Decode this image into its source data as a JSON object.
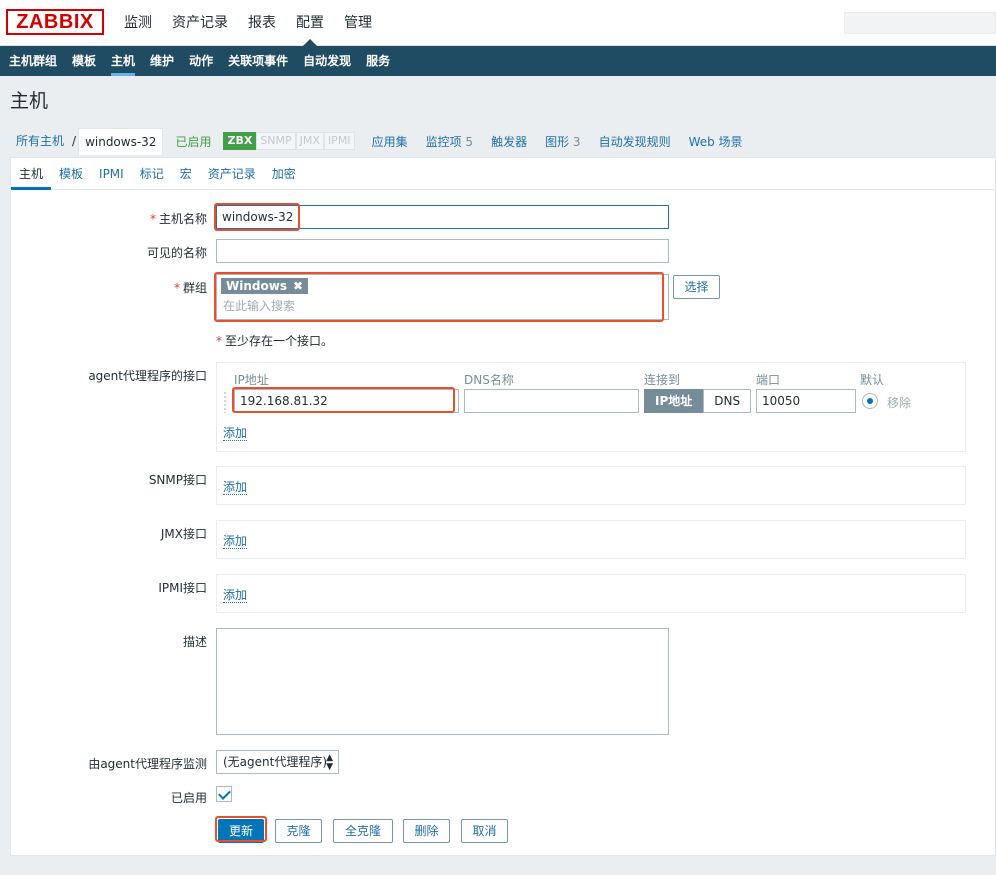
{
  "app": {
    "logo": "ZABBIX"
  },
  "main_menu": [
    {
      "label": "监测"
    },
    {
      "label": "资产记录"
    },
    {
      "label": "报表"
    },
    {
      "label": "配置",
      "active": true
    },
    {
      "label": "管理"
    }
  ],
  "sub_menu": [
    {
      "label": "主机群组"
    },
    {
      "label": "模板"
    },
    {
      "label": "主机",
      "active": true
    },
    {
      "label": "维护"
    },
    {
      "label": "动作"
    },
    {
      "label": "关联项事件"
    },
    {
      "label": "自动发现"
    },
    {
      "label": "服务"
    }
  ],
  "page_title": "主机",
  "host_nav": {
    "all_hosts": "所有主机",
    "sep": "/",
    "current_host": "windows-32",
    "status": "已启用",
    "badges": [
      "ZBX",
      "SNMP",
      "JMX",
      "IPMI"
    ],
    "links": [
      {
        "label": "应用集",
        "count": ""
      },
      {
        "label": "监控项",
        "count": "5"
      },
      {
        "label": "触发器",
        "count": ""
      },
      {
        "label": "图形",
        "count": "3"
      },
      {
        "label": "自动发现规则",
        "count": ""
      },
      {
        "label": "Web 场景",
        "count": ""
      }
    ]
  },
  "tabs": [
    {
      "label": "主机",
      "active": true
    },
    {
      "label": "模板"
    },
    {
      "label": "IPMI"
    },
    {
      "label": "标记"
    },
    {
      "label": "宏"
    },
    {
      "label": "资产记录"
    },
    {
      "label": "加密"
    }
  ],
  "form": {
    "required_mark": "*",
    "host_name_label": "主机名称",
    "host_name_value": "windows-32",
    "visible_name_label": "可见的名称",
    "visible_name_value": "",
    "groups_label": "群组",
    "group_chip": "Windows",
    "chip_remove": "✖",
    "groups_placeholder": "在此输入搜索",
    "select_button": "选择",
    "interface_note": "至少存在一个接口。",
    "agent_if_label": "agent代理程序的接口",
    "if_headers": {
      "ip": "IP地址",
      "dns": "DNS名称",
      "connect": "连接到",
      "port": "端口",
      "default": "默认"
    },
    "ip_value": "192.168.81.32",
    "dns_value": "",
    "connect_ip": "IP地址",
    "connect_dns": "DNS",
    "port_value": "10050",
    "remove_label": "移除",
    "add_label": "添加",
    "snmp_label": "SNMP接口",
    "jmx_label": "JMX接口",
    "ipmi_label": "IPMI接口",
    "description_label": "描述",
    "description_value": "",
    "proxy_label": "由agent代理程序监测",
    "proxy_value": "(无agent代理程序)",
    "enabled_label": "已启用",
    "buttons": {
      "update": "更新",
      "clone": "克隆",
      "full_clone": "全克隆",
      "delete": "删除",
      "cancel": "取消"
    }
  }
}
